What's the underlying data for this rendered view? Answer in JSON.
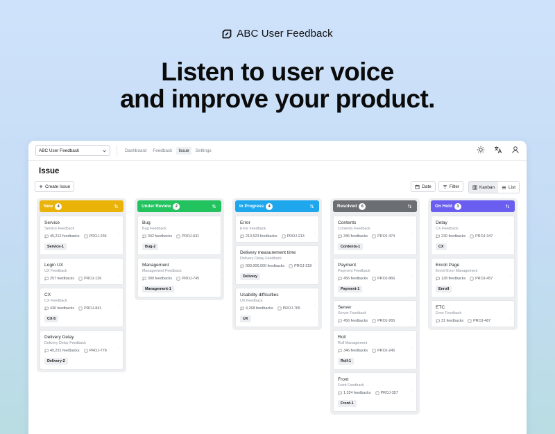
{
  "brand": {
    "name": "ABC User Feedback",
    "logo_icon": "abc-logo-icon"
  },
  "hero": {
    "line1": "Listen to user voice",
    "line2": "and improve your product."
  },
  "topbar": {
    "workspace": "ABC User Feedback",
    "nav": [
      "Dashboard",
      "Feedback",
      "Issue",
      "Settings"
    ],
    "active_nav": "Issue",
    "icons": [
      "sun-icon",
      "translate-icon",
      "user-icon"
    ]
  },
  "page": {
    "title": "Issue",
    "create_label": "Create Issue"
  },
  "toolbar": {
    "date_label": "Date",
    "filter_label": "Filter",
    "kanban_label": "Kanban",
    "list_label": "List",
    "active_view": "Kanban"
  },
  "columns": [
    {
      "name": "New",
      "count": "4",
      "color": "#eab30a",
      "cards": [
        {
          "title": "Service",
          "subtitle": "Service Feedback",
          "feedbacks": "45,212 feedbacks",
          "project": "PROJ-234",
          "tag": "Service-1"
        },
        {
          "title": "Login UX",
          "subtitle": "UX Feedback",
          "feedbacks": "257 feedbacks",
          "project": "PROJ-126",
          "tag": ""
        },
        {
          "title": "CX",
          "subtitle": "CX Feedback",
          "feedbacks": "436 feedbacks",
          "project": "PROJ-841",
          "tag": "CX-5"
        },
        {
          "title": "Delivery Delay",
          "subtitle": "Delivery Delay Feedback",
          "feedbacks": "45,231 feedbacks",
          "project": "PROJ-778",
          "tag": "Delivery-2"
        }
      ]
    },
    {
      "name": "Under Review",
      "count": "2",
      "color": "#22c35e",
      "cards": [
        {
          "title": "Bug",
          "subtitle": "Bug Feedback",
          "feedbacks": "342 feedbacks",
          "project": "PROJ-631",
          "tag": "Bug-2"
        },
        {
          "title": "Management",
          "subtitle": "Management Feedback",
          "feedbacks": "390 feedbacks",
          "project": "PROJ-745",
          "tag": "Management-1"
        }
      ]
    },
    {
      "name": "In Progress",
      "count": "4",
      "color": "#1ea7ec",
      "cards": [
        {
          "title": "Error",
          "subtitle": "Error Feedback",
          "feedbacks": "213,523 feedbacks",
          "project": "PROJ-213",
          "tag": ""
        },
        {
          "title": "Delivery measurement time",
          "subtitle": "Delivery Delay Feedback",
          "feedbacks": "000,000,000 feedbacks",
          "project": "PROJ-318",
          "tag": "Delivery"
        },
        {
          "title": "Usability difficulties",
          "subtitle": "UX Feedback",
          "feedbacks": "4,268 feedbacks",
          "project": "PROJ-765",
          "tag": "UX"
        }
      ]
    },
    {
      "name": "Resolved",
      "count": "6",
      "color": "#6b6e73",
      "cards": [
        {
          "title": "Contents",
          "subtitle": "Contents Feedback",
          "feedbacks": "346 feedbacks",
          "project": "PROJ-474",
          "tag": "Contents-1"
        },
        {
          "title": "Payment",
          "subtitle": "Payment Feedback",
          "feedbacks": "456 feedbacks",
          "project": "PROJ-866",
          "tag": "Payment-1"
        },
        {
          "title": "Server",
          "subtitle": "Server Feedback",
          "feedbacks": "456 feedbacks",
          "project": "PROJ-265",
          "tag": ""
        },
        {
          "title": "Roll",
          "subtitle": "Roll Management",
          "feedbacks": "346 feedbacks",
          "project": "PROJ-245",
          "tag": "Roll-1"
        },
        {
          "title": "Front",
          "subtitle": "Front Feedback",
          "feedbacks": "1,324 feedbacks",
          "project": "PROJ-357",
          "tag": "Front-1"
        }
      ]
    },
    {
      "name": "On Hold",
      "count": "3",
      "color": "#6a5ef0",
      "cards": [
        {
          "title": "Delay",
          "subtitle": "CX Feedback",
          "feedbacks": "230 feedbacks",
          "project": "PROJ-347",
          "tag": "CX"
        },
        {
          "title": "Enroll Page",
          "subtitle": "Enroll Error Management",
          "feedbacks": "128 feedbacks",
          "project": "PROJ-457",
          "tag": "Enroll"
        },
        {
          "title": "ETC",
          "subtitle": "Error Feedback",
          "feedbacks": "31 feedbacks",
          "project": "PROJ-487",
          "tag": ""
        }
      ]
    }
  ]
}
